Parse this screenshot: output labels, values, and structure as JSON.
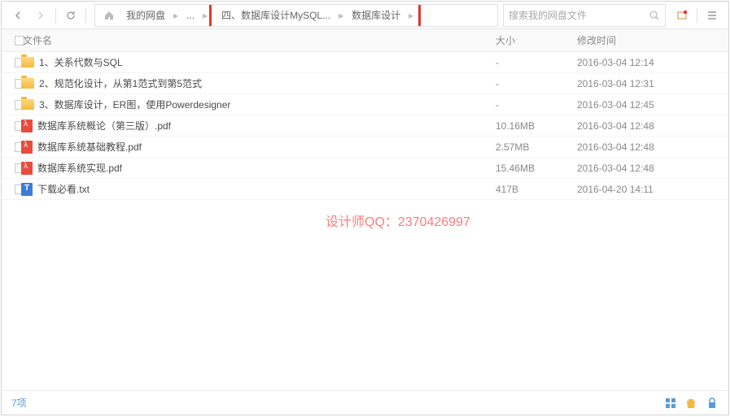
{
  "breadcrumb": {
    "root": "我的网盘",
    "ellipsis": "...",
    "mid": "四、数据库设计MySQL...",
    "current": "数据库设计"
  },
  "search": {
    "placeholder": "搜索我的网盘文件"
  },
  "columns": {
    "name": "文件名",
    "size": "大小",
    "time": "修改时间"
  },
  "files": [
    {
      "type": "folder",
      "name": "1、关系代数与SQL",
      "size": "-",
      "time": "2016-03-04 12:14"
    },
    {
      "type": "folder",
      "name": "2、规范化设计，从第1范式到第5范式",
      "size": "-",
      "time": "2016-03-04 12:31"
    },
    {
      "type": "folder",
      "name": "3、数据库设计，ER图，使用Powerdesigner",
      "size": "-",
      "time": "2016-03-04 12:45"
    },
    {
      "type": "pdf",
      "name": "数据库系统概论（第三版）.pdf",
      "size": "10.16MB",
      "time": "2016-03-04 12:48"
    },
    {
      "type": "pdf",
      "name": "数据库系统基础教程.pdf",
      "size": "2.57MB",
      "time": "2016-03-04 12:48"
    },
    {
      "type": "pdf",
      "name": "数据库系统实现.pdf",
      "size": "15.46MB",
      "time": "2016-03-04 12:48"
    },
    {
      "type": "txt",
      "name": "下载必看.txt",
      "size": "417B",
      "time": "2016-04-20 14:11"
    }
  ],
  "watermark": "设计师QQ：2370426997",
  "status": {
    "count": "7项"
  }
}
